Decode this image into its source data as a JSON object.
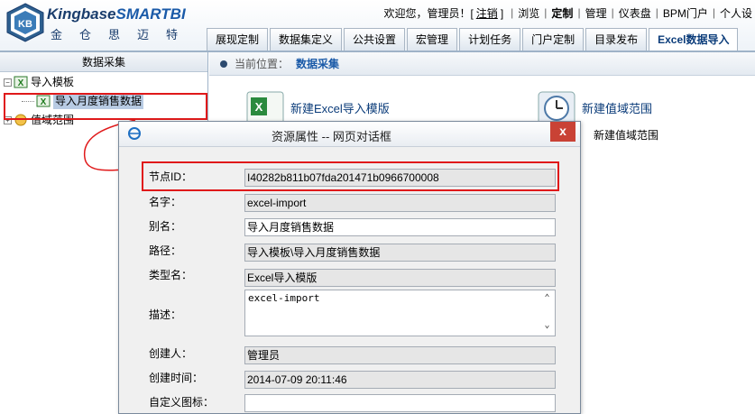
{
  "header": {
    "logo_main": "Kingbase",
    "logo_accent": "SMARTBI",
    "logo_sub": "金仓思迈特",
    "top_links": {
      "welcome": "欢迎您，管理员！[",
      "logout": "注销",
      "welcome_end": "]",
      "browse": "浏览",
      "customize": "定制",
      "manage": "管理",
      "dashboard": "仪表盘",
      "bpm": "BPM门户",
      "personal": "个人设"
    },
    "tabs": [
      "展现定制",
      "数据集定义",
      "公共设置",
      "宏管理",
      "计划任务",
      "门户定制",
      "目录发布",
      "Excel数据导入"
    ],
    "active_tab": "Excel数据导入"
  },
  "left_panel": {
    "title": "数据采集",
    "tree": {
      "root1": "导入模板",
      "child1": "导入月度销售数据",
      "root2": "值域范围"
    }
  },
  "breadcrumb": {
    "label": "当前位置：",
    "current": "数据采集"
  },
  "actions": {
    "new_excel_template": "新建Excel导入模版",
    "new_value_range": "新建值域范围",
    "new_value_range_sub": "新建值域范围"
  },
  "dialog": {
    "title": "资源属性 -- 网页对话框",
    "close": "x",
    "fields": {
      "node_id_label": "节点ID：",
      "node_id": "I40282b811b07fda201471b0966700008",
      "name_label": "名字：",
      "name": "excel-import",
      "alias_label": "别名：",
      "alias": "导入月度销售数据",
      "path_label": "路径：",
      "path": "导入模板\\导入月度销售数据",
      "type_label": "类型名：",
      "type": "Excel导入模版",
      "desc_label": "描述：",
      "desc": "excel-import",
      "creator_label": "创建人：",
      "creator": "管理员",
      "created_label": "创建时间：",
      "created": "2014-07-09 20:11:46",
      "custom_icon_label": "自定义图标：",
      "custom_icon": ""
    }
  },
  "colors": {
    "highlight": "#e0191a",
    "link_blue": "#1a5aa8",
    "close_red": "#c94235"
  }
}
